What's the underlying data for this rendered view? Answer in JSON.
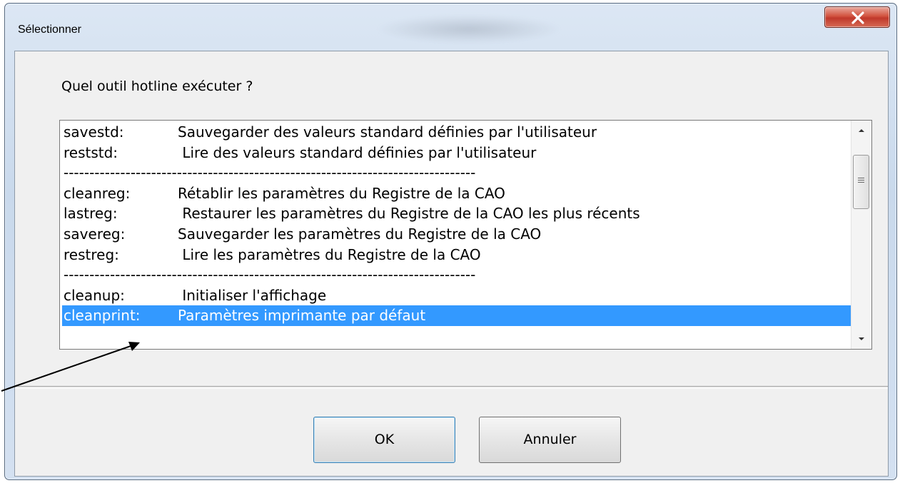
{
  "window": {
    "title": "Sélectionner"
  },
  "dialog": {
    "prompt": "Quel outil hotline exécuter ?",
    "items": [
      {
        "code": "savestd:",
        "desc": "Sauvegarder des valeurs standard définies par l'utilisateur",
        "type": "item"
      },
      {
        "code": "reststd:",
        "desc": " Lire des valeurs standard définies par l'utilisateur",
        "type": "item"
      },
      {
        "code": "",
        "desc": "--------------------------------------------------------------------------------",
        "type": "separator"
      },
      {
        "code": "cleanreg:",
        "desc": "Rétablir les paramètres du Registre de la CAO",
        "type": "item"
      },
      {
        "code": "lastreg:",
        "desc": " Restaurer les paramètres du Registre de la CAO les plus récents",
        "type": "item"
      },
      {
        "code": "savereg:",
        "desc": "Sauvegarder les paramètres du Registre de la CAO",
        "type": "item"
      },
      {
        "code": "restreg:",
        "desc": " Lire les paramètres du Registre de la CAO",
        "type": "item"
      },
      {
        "code": "",
        "desc": "--------------------------------------------------------------------------------",
        "type": "separator"
      },
      {
        "code": "cleanup:",
        "desc": " Initialiser l'affichage",
        "type": "item"
      },
      {
        "code": "cleanprint:",
        "desc": "Paramètres imprimante par défaut",
        "type": "item",
        "selected": true
      }
    ],
    "ok_label": "OK",
    "cancel_label": "Annuler"
  },
  "colors": {
    "selection": "#3399ff",
    "close_button": "#c0392b"
  },
  "icons": {
    "close": "close-icon",
    "scroll_up": "chevron-up-icon",
    "scroll_down": "chevron-down-icon"
  }
}
